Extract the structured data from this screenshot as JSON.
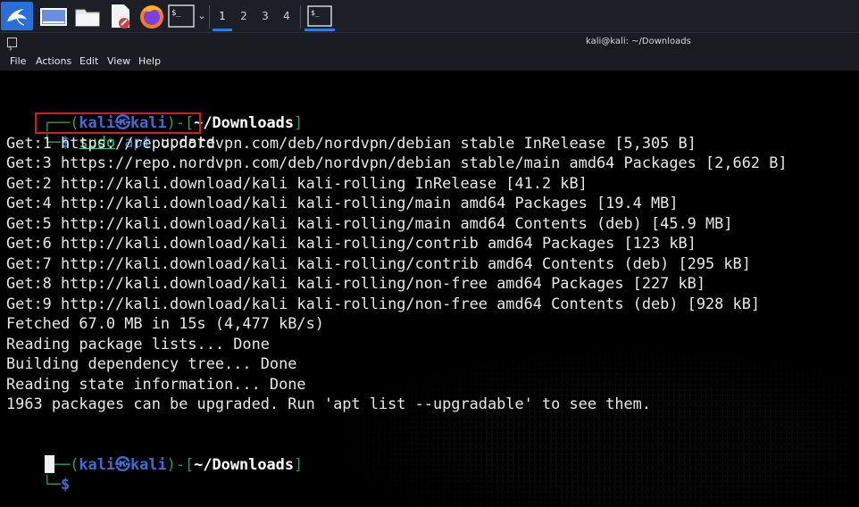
{
  "taskbar": {
    "workspaces": [
      "1",
      "2",
      "3",
      "4"
    ],
    "terminal_icon_label": "$_"
  },
  "window": {
    "title": "kali@kali: ~/Downloads",
    "menu": [
      "File",
      "Actions",
      "Edit",
      "View",
      "Help"
    ]
  },
  "prompt": {
    "user": "kali",
    "host": "kali",
    "at_symbol": "㉿",
    "cwd": "~/Downloads",
    "dollar": "$"
  },
  "command": {
    "sudo": "sudo",
    "apt": "apt",
    "args": "update"
  },
  "output": [
    "Get:1 https://repo.nordvpn.com/deb/nordvpn/debian stable InRelease [5,305 B]",
    "Get:3 https://repo.nordvpn.com/deb/nordvpn/debian stable/main amd64 Packages [2,662 B]",
    "Get:2 http://kali.download/kali kali-rolling InRelease [41.2 kB]",
    "Get:4 http://kali.download/kali kali-rolling/main amd64 Packages [19.4 MB]",
    "Get:5 http://kali.download/kali kali-rolling/main amd64 Contents (deb) [45.9 MB]",
    "Get:6 http://kali.download/kali kali-rolling/contrib amd64 Packages [123 kB]",
    "Get:7 http://kali.download/kali kali-rolling/contrib amd64 Contents (deb) [295 kB]",
    "Get:8 http://kali.download/kali kali-rolling/non-free amd64 Packages [227 kB]",
    "Get:9 http://kali.download/kali kali-rolling/non-free amd64 Contents (deb) [928 kB]",
    "Fetched 67.0 MB in 15s (4,477 kB/s)",
    "Reading package lists... Done",
    "Building dependency tree... Done",
    "Reading state information... Done",
    "1963 packages can be upgraded. Run 'apt list --upgradable' to see them."
  ],
  "colors": {
    "prompt_frame": "#2f9e4f",
    "prompt_user": "#3f6dd6",
    "sudo": "#2fd08a",
    "apt": "#3f7ee8",
    "highlight": "#d11f1f",
    "taskbar_accent": "#2f7be6"
  },
  "icons": [
    "kali-menu-icon",
    "desktop-icon",
    "file-manager-icon",
    "text-editor-icon",
    "firefox-icon",
    "terminal-icon",
    "terminal-window-icon"
  ]
}
